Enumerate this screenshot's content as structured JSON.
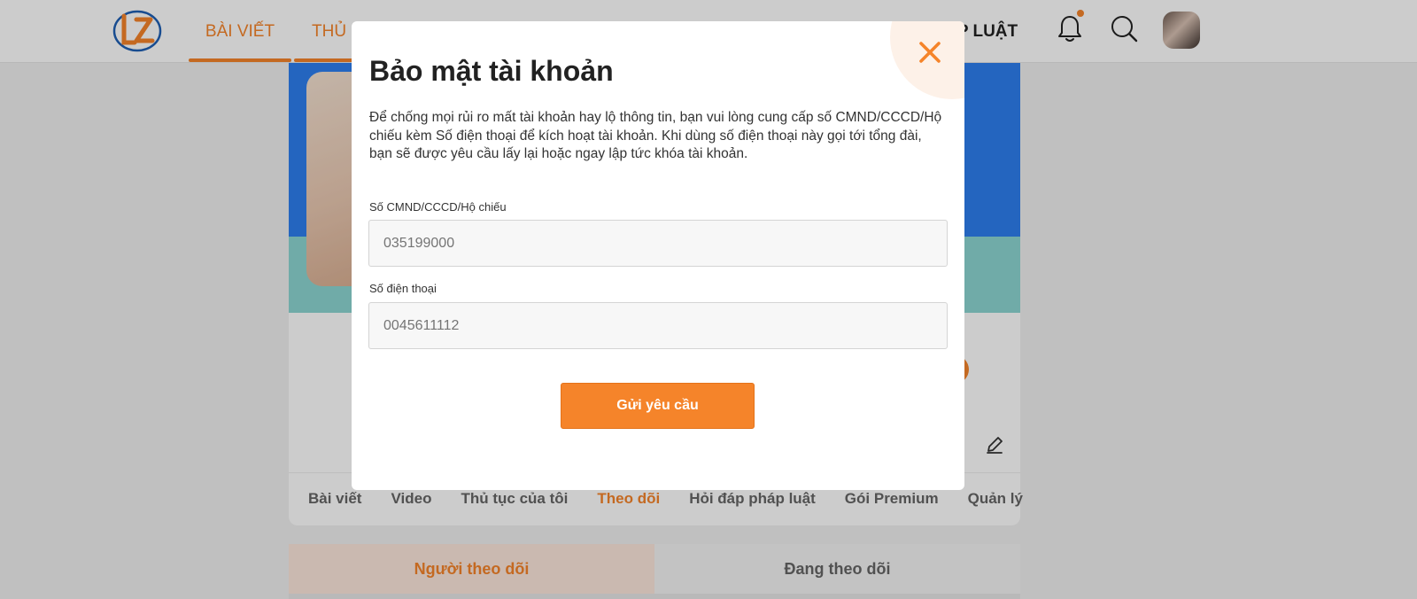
{
  "header": {
    "nav_items": [
      {
        "label": "BÀI VIẾT"
      },
      {
        "label": "THỦ"
      },
      {
        "label": "P LUẬT"
      }
    ],
    "bell_icon": "bell-icon",
    "search_icon": "search-icon"
  },
  "profile": {
    "tabs": [
      {
        "label": "Bài viết"
      },
      {
        "label": "Video"
      },
      {
        "label": "Thủ tục của tôi"
      },
      {
        "label": "Theo dõi",
        "active": true
      },
      {
        "label": "Hỏi đáp pháp luật"
      },
      {
        "label": "Gói Premium"
      },
      {
        "label": "Quản lý"
      }
    ],
    "follow_tabs": [
      {
        "label": "Người theo dõi",
        "active": true
      },
      {
        "label": "Đang theo dõi"
      }
    ]
  },
  "modal": {
    "title": "Bảo mật tài khoản",
    "description": "Để chống mọi rủi ro mất tài khoản hay lộ thông tin, bạn vui lòng cung cấp số CMND/CCCD/Hộ chiếu kèm Số điện thoại để kích hoạt tài khoản. Khi dùng số điện thoại này gọi tới tổng đài, bạn sẽ được yêu cầu lấy lại hoặc ngay lập tức khóa tài khoản.",
    "id_label": "Số CMND/CCCD/Hộ chiếu",
    "id_placeholder": "035199000",
    "phone_label": "Số điện thoại",
    "phone_placeholder": "0045611112",
    "submit_label": "Gửi yêu cầu"
  },
  "colors": {
    "accent": "#f5842a",
    "cover_blue": "#2e7fef",
    "cover_teal": "#8cd6d3"
  }
}
